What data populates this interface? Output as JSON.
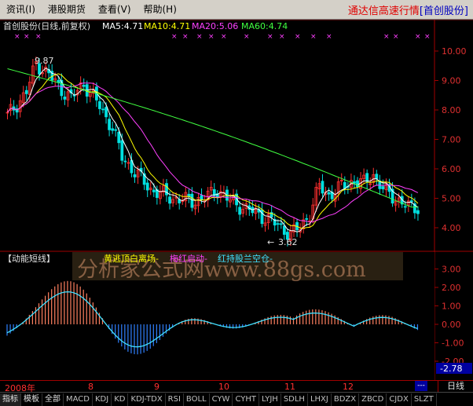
{
  "menu": {
    "items": [
      "资讯(I)",
      "港股期货",
      "查看(V)",
      "帮助(H)"
    ],
    "brand_title": "通达信高速行情",
    "brand_stock": "[首创股份]"
  },
  "main_chart": {
    "stock_title": "首创股份(日线,前复权)",
    "ma_labels": [
      {
        "text": "MA5:4.71",
        "color": "#ffffff"
      },
      {
        "text": "MA10:4.71",
        "color": "#ffff00"
      },
      {
        "text": "MA20:5.06",
        "color": "#ff40ff"
      },
      {
        "text": "MA60:4.74",
        "color": "#40ff40"
      }
    ],
    "price_ticks": [
      "10.00",
      "9.00",
      "8.00",
      "7.00",
      "6.00",
      "5.00",
      "4.00"
    ],
    "high_label": "9.87",
    "low_label": "3.62"
  },
  "sub_chart": {
    "title": "【动能短线】",
    "legend_yellow": "黄逃顶白离场-",
    "legend_pink": "梅红启动-",
    "legend_cyan": "红持股兰空仓-",
    "ticks": [
      "3.00",
      "2.00",
      "1.00",
      "0.00",
      "-1.00",
      "-2.00"
    ],
    "current_value": "-2.78",
    "watermark": "分析家公式网www.88gs.com"
  },
  "date_axis": {
    "labels": [
      "2008年",
      "8",
      "9",
      "10",
      "11",
      "12"
    ],
    "period": "日线",
    "scroll_marker": "---"
  },
  "tabs": [
    "指标",
    "模板",
    "全部",
    "MACD",
    "KDJ",
    "KD",
    "KDJ-TDX",
    "RSI",
    "BOLL",
    "CYW",
    "CYHT",
    "LYJH",
    "SDLH",
    "LHXJ",
    "BDZX",
    "ZBCD",
    "CJDX",
    "SLZT"
  ],
  "colors": {
    "up": "#ff3030",
    "down": "#00e0e0",
    "ma5": "#ffffff",
    "ma10": "#ffff00",
    "ma20": "#ff40ff",
    "ma60": "#40ff40",
    "axis": "#a00000"
  }
}
